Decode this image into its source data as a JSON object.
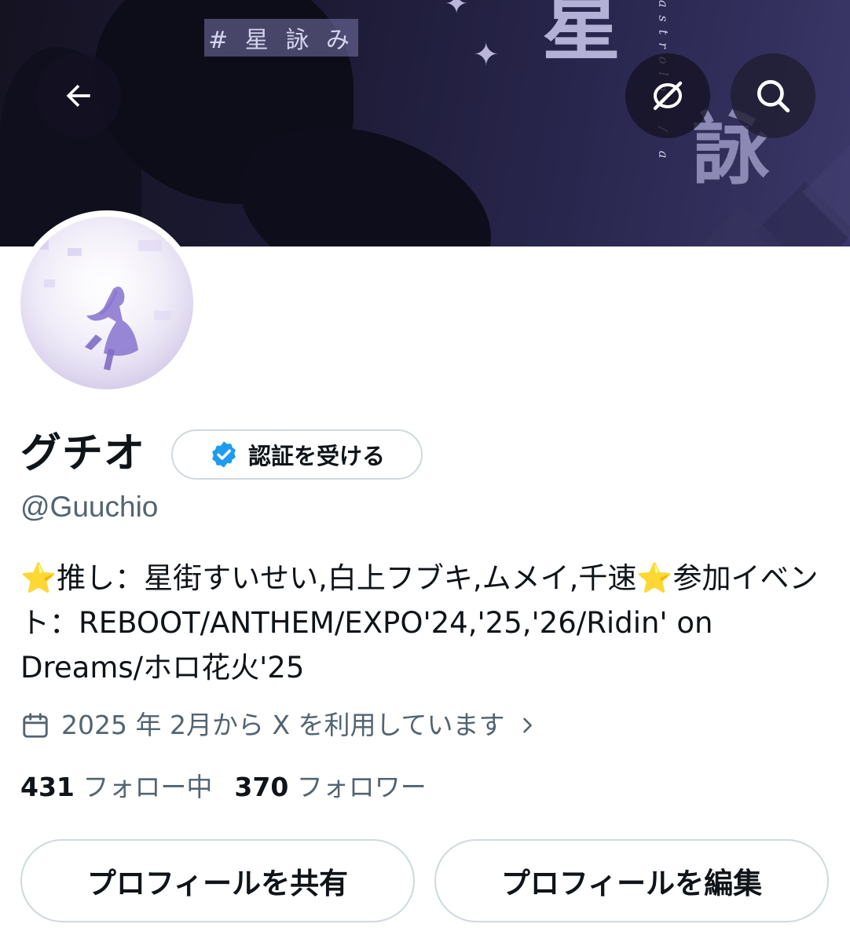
{
  "banner": {
    "hashtag": "# 星 詠 み",
    "title_char_top": "星",
    "title_char_bottom": "詠",
    "vertical_text": "astrolog / a"
  },
  "nav": {
    "back_icon": "arrow-left-icon",
    "visibility_icon": "eye-off-icon",
    "search_icon": "search-icon"
  },
  "profile": {
    "display_name": "グチオ",
    "verify_label": "認証を受ける",
    "handle": "@Guuchio",
    "bio_star": "⭐",
    "bio_part1": "推し：星街すいせい,白上フブキ,ムメイ,千速",
    "bio_part2": "参加イベント：REBOOT/ANTHEM/EXPO'24,'25,'26/Ridin' on Dreams/ホロ花火'25",
    "joined": "2025 年 2月から X を利用しています",
    "following_count": "431",
    "following_label": "フォロー中",
    "followers_count": "370",
    "followers_label": "フォロワー"
  },
  "actions": {
    "share_label": "プロフィールを共有",
    "edit_label": "プロフィールを編集"
  },
  "colors": {
    "text_primary": "#0f1419",
    "text_secondary": "#536471",
    "border": "#cfd9de",
    "verified_blue": "#1d9bf0",
    "banner_dark": "#151322"
  }
}
